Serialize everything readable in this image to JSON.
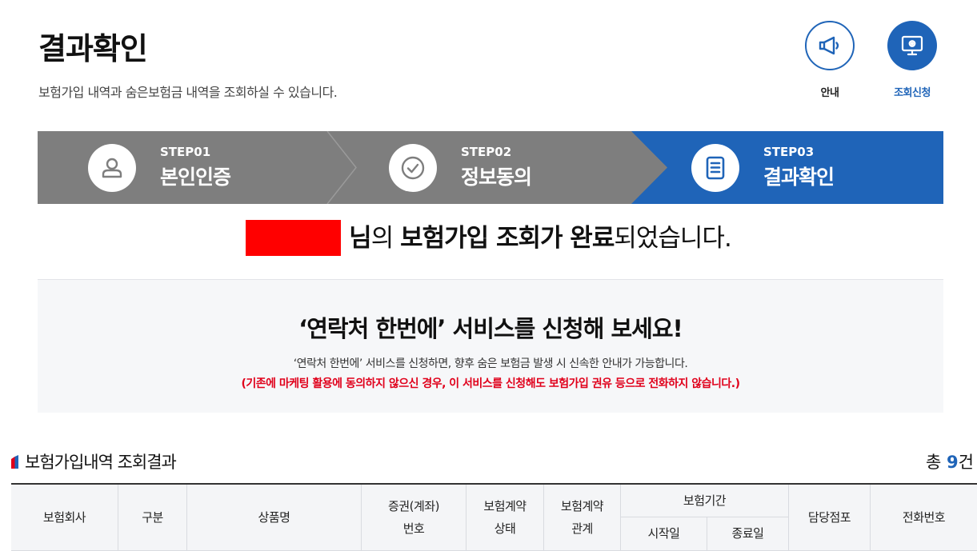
{
  "header": {
    "title": "결과확인",
    "description": "보험가입 내역과 숨은보험금 내역을 조회하실 수 있습니다.",
    "guide_label": "안내",
    "query_label": "조회신청"
  },
  "steps": [
    {
      "num": "STEP01",
      "name": "본인인증",
      "icon": "person-icon",
      "state": "done"
    },
    {
      "num": "STEP02",
      "name": "정보동의",
      "icon": "check-circle-icon",
      "state": "done"
    },
    {
      "num": "STEP03",
      "name": "결과확인",
      "icon": "document-icon",
      "state": "current"
    }
  ],
  "result": {
    "suffix_a": "님",
    "particle": "의 ",
    "strong_a": "보험가입 조회가 완료",
    "suffix_b": "되었습니다."
  },
  "promo": {
    "title": "‘연락처 한번에’ 서비스를 신청해 보세요!",
    "desc": "‘연락처 한번에’ 서비스를 신청하면, 향후 숨은 보험금 발생 시 신속한 안내가 가능합니다.",
    "warn": "(기존에 마케팅 활용에 동의하지 않으신 경우, 이 서비스를 신청해도 보험가입 권유 등으로 전화하지 않습니다.)"
  },
  "section": {
    "title": "보험가입내역 조회결과",
    "count_prefix": "총 ",
    "count": "9",
    "count_suffix": "건"
  },
  "table": {
    "company": "보험회사",
    "category": "구분",
    "product": "상품명",
    "policy_no_1": "증권(계좌)",
    "policy_no_2": "번호",
    "contract_status_1": "보험계약",
    "contract_status_2": "상태",
    "contract_rel_1": "보험계약",
    "contract_rel_2": "관계",
    "period": "보험기간",
    "start": "시작일",
    "end": "종료일",
    "branch": "담당점포",
    "phone": "전화번호"
  },
  "colors": {
    "accent": "#1f64b8",
    "step_gray": "#7e7e7e",
    "warning": "#e0001b",
    "redaction": "#ff0000"
  }
}
